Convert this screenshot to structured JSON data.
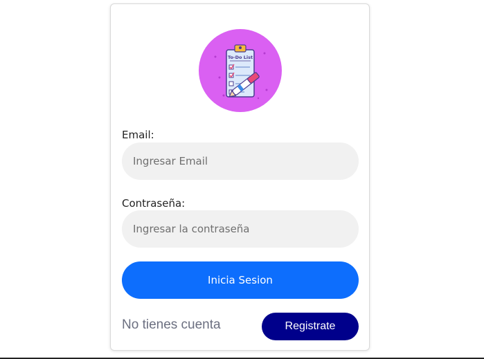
{
  "login": {
    "logo_text": "To-Do List",
    "email_label": "Email:",
    "email_placeholder": "Ingresar Email",
    "email_value": "",
    "password_label": "Contraseña:",
    "password_placeholder": "Ingresar la contraseña",
    "password_value": "",
    "submit_label": "Inicia Sesion",
    "no_account_text": "No tienes cuenta",
    "register_label": "Registrate"
  },
  "colors": {
    "logo_bg": "#da60f2",
    "primary_button": "#0d6efd",
    "register_button": "#00008b",
    "input_bg": "#f1f1f1"
  },
  "icons": {
    "logo": "todo-clipboard-pen-icon"
  }
}
